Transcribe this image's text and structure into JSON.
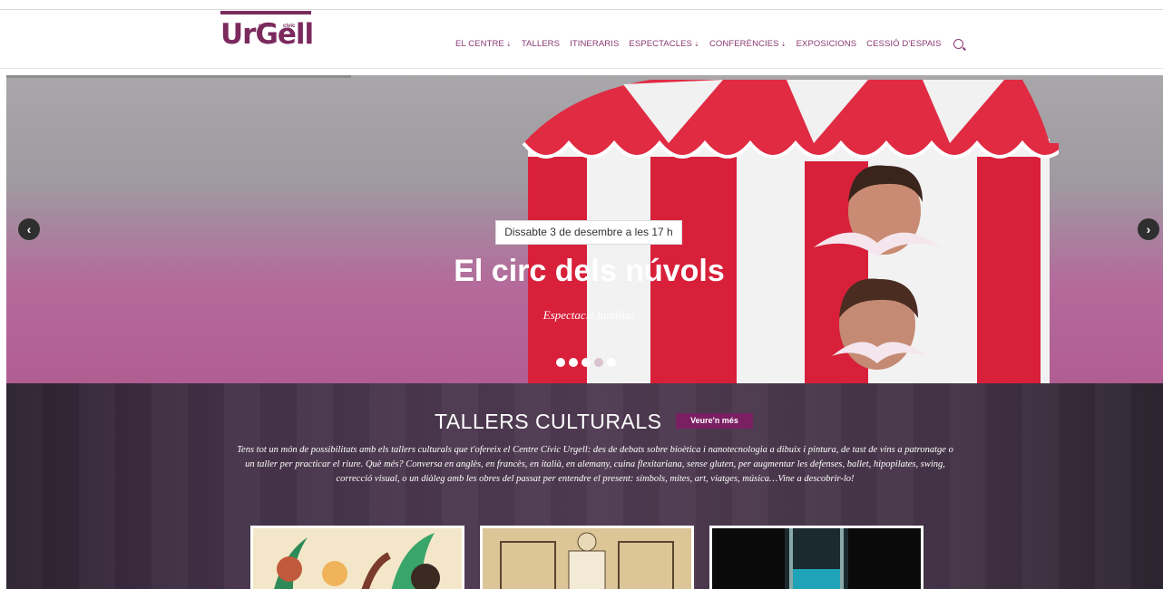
{
  "header": {
    "logo": {
      "main": "UrGell",
      "small_left": "centre",
      "small_right": "cívic"
    },
    "nav": [
      {
        "label": "EL CENTRE",
        "dropdown": true
      },
      {
        "label": "TALLERS",
        "dropdown": false
      },
      {
        "label": "ITINERARIS",
        "dropdown": false
      },
      {
        "label": "ESPECTACLES",
        "dropdown": true
      },
      {
        "label": "CONFERÈNCIES",
        "dropdown": true
      },
      {
        "label": "EXPOSICIONS",
        "dropdown": false
      },
      {
        "label": "CESSIÓ D'ESPAIS",
        "dropdown": false
      }
    ],
    "search_icon": "search-icon"
  },
  "hero": {
    "date": "Dissabte 3 de desembre a les 17 h",
    "title": "El circ dels núvols",
    "subtitle": "Espectacle familiar",
    "prev_icon": "chevron-left-icon",
    "next_icon": "chevron-right-icon",
    "slides_total": 5,
    "slide_active": 4
  },
  "section": {
    "title": "TALLERS CULTURALS",
    "more_label": "Veure'n més",
    "description": "Tens tot un món de possibilitats amb els tallers culturals que t'ofereix el Centre Cívic Urgell: des de debats sobre bioètica i nanotecnologia a dibuix i pintura, de tast de vins a patronatge o un taller per practicar el riure. Què més? Conversa en anglès, en francès, en italià, en alemany, cuina flexitariana, sense gluten, per augmentar les defenses, ballet, hipopilates, swing, correcció visual, o un diàleg amb les obres del passat per entendre el present: símbols, mites, art, viatges, música…Vine a descobrir-lo!"
  },
  "colors": {
    "brand": "#7b2a5e",
    "nav_text": "#8a3a74",
    "button": "#7b1f63"
  }
}
